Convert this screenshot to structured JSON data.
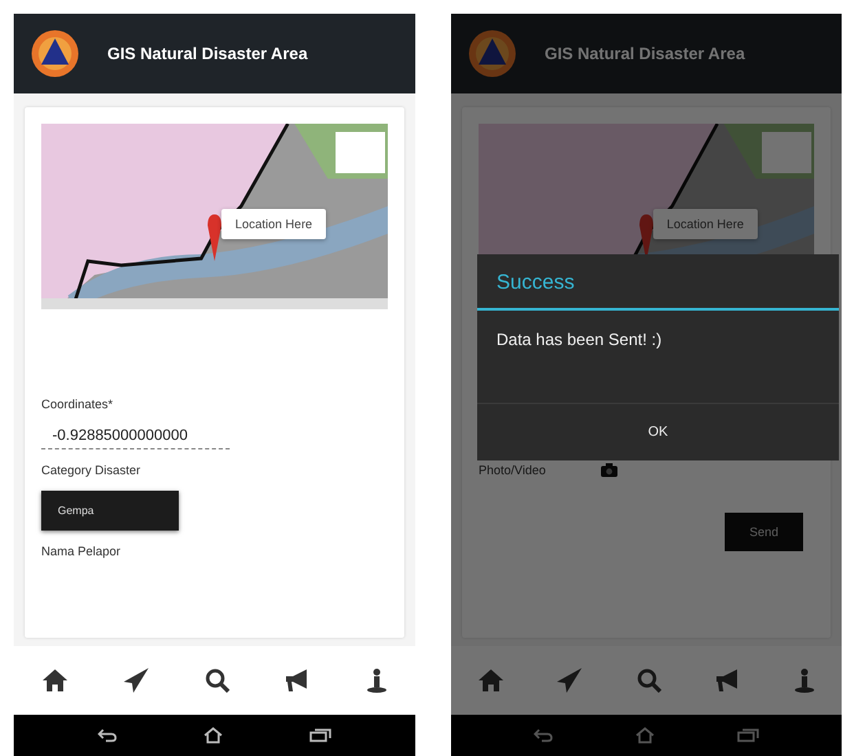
{
  "screens": [
    {
      "header": {
        "title": "GIS Natural Disaster Area"
      },
      "map": {
        "popup": "Location Here"
      },
      "form": [
        {
          "kind": "label",
          "text": "Coordinates*"
        },
        {
          "kind": "input",
          "value": "-0.92885000000000"
        },
        {
          "kind": "label",
          "text": "Category Disaster"
        },
        {
          "kind": "select",
          "value": "Gempa"
        },
        {
          "kind": "label",
          "text": "Nama Pelapor"
        }
      ]
    },
    {
      "header": {
        "title": "GIS Natural Disaster Area"
      },
      "map": {
        "popup": "Location Here"
      },
      "form": [
        {
          "kind": "photo",
          "text": "Photo/Video"
        },
        {
          "kind": "button",
          "text": "Send"
        }
      ],
      "dialog": {
        "title": "Success",
        "message": "Data has been Sent! :)",
        "button": "OK"
      }
    }
  ]
}
